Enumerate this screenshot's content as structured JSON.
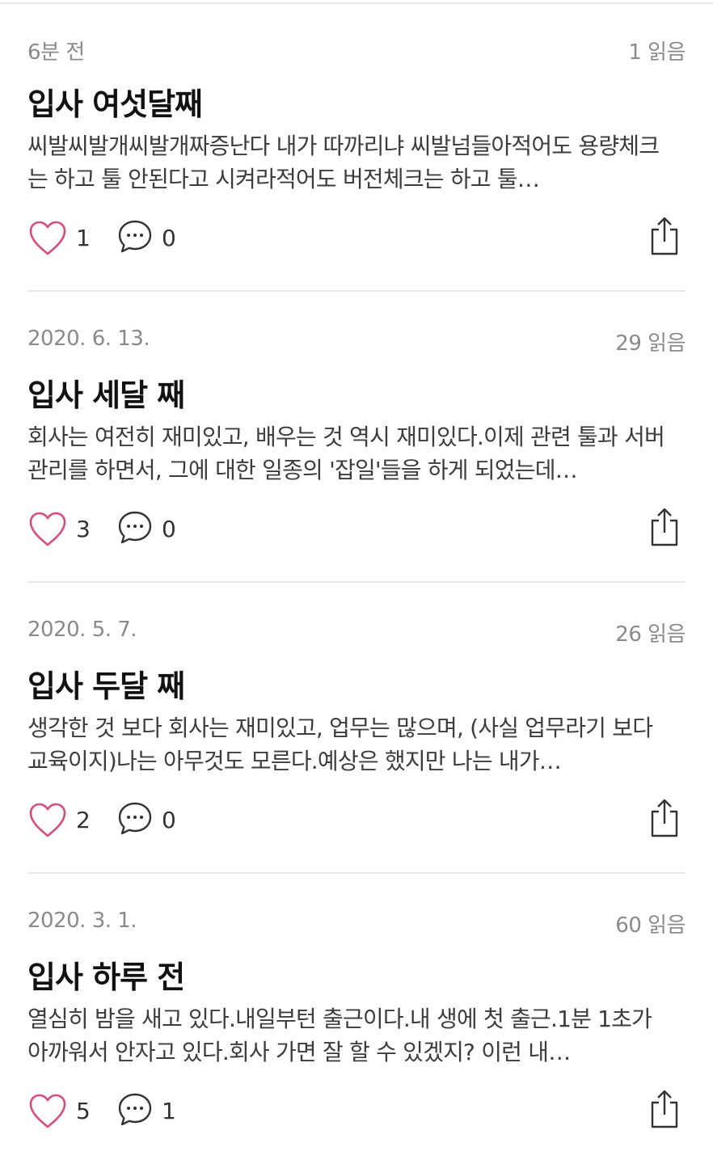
{
  "posts": [
    {
      "date": "6분 전",
      "reads": "1 읽음",
      "title": "입사 여섯달째",
      "excerpt": "씨발씨발개씨발개짜증난다 내가 따까리냐 씨발넘들아적어도 용량체크는 하고 툴 안된다고 시켜라적어도 버전체크는 하고 툴…",
      "likes": "1",
      "comments": "0"
    },
    {
      "date": "2020. 6. 13.",
      "reads": "29 읽음",
      "title": "입사 세달 째",
      "excerpt": "회사는 여전히 재미있고, 배우는 것 역시 재미있다.이제 관련 툴과 서버 관리를 하면서, 그에 대한 일종의 '잡일'들을 하게 되었는데…",
      "likes": "3",
      "comments": "0"
    },
    {
      "date": "2020. 5. 7.",
      "reads": "26 읽음",
      "title": "입사 두달 째",
      "excerpt": "생각한 것 보다 회사는 재미있고, 업무는 많으며, (사실 업무라기 보다 교육이지)나는 아무것도 모른다.예상은 했지만 나는 내가…",
      "likes": "2",
      "comments": "0"
    },
    {
      "date": "2020. 3. 1.",
      "reads": "60 읽음",
      "title": "입사 하루 전",
      "excerpt": "열심히 밤을 새고 있다.내일부턴 출근이다.내 생에 첫 출근.1분 1초가 아까워서 안자고 있다.회사 가면 잘 할 수 있겠지? 이런 내…",
      "likes": "5",
      "comments": "1"
    }
  ],
  "icons": {
    "like": "heart-outline-icon",
    "comment": "speech-bubble-ellipsis-icon",
    "share": "share-upload-icon"
  },
  "colors": {
    "heart": "#e0487a",
    "icon_gray": "#333333",
    "meta_text": "#8a8a8a",
    "divider": "#e9e9e9"
  }
}
